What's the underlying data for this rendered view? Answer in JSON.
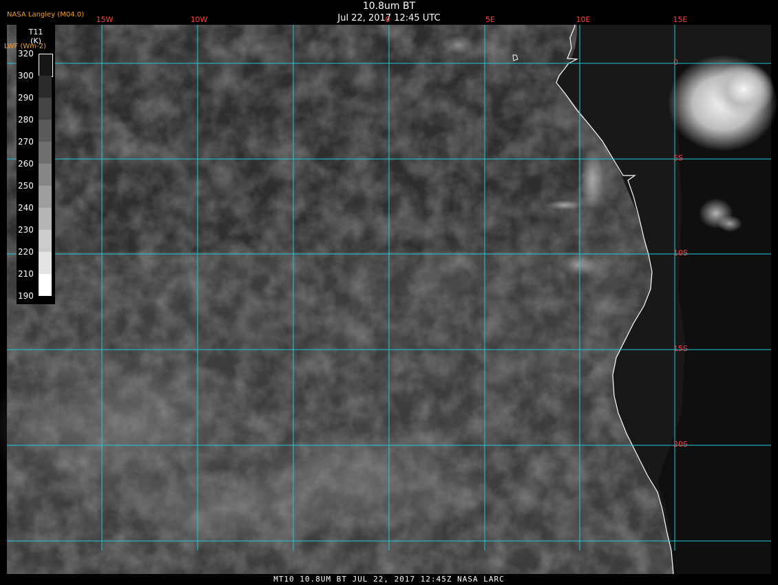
{
  "header": {
    "title": "10.8um BT",
    "subtitle": "Jul 22, 2017 12:45 UTC",
    "credit": "NASA Langley (M04.0)"
  },
  "colorbar": {
    "title": "T11",
    "unit": "(K)",
    "secondary_label": "LWF (Wm-2)",
    "ticks": [
      "320",
      "300",
      "290",
      "280",
      "270",
      "260",
      "250",
      "240",
      "230",
      "220",
      "210",
      "190"
    ]
  },
  "grid": {
    "longitudes": [
      "15W",
      "10W",
      "0",
      "5E",
      "10E",
      "15E"
    ],
    "latitudes": [
      "0",
      "5S",
      "10S",
      "15S",
      "20S"
    ]
  },
  "footer": {
    "text": "MT10  10.8UM BT   JUL 22, 2017 12:45Z  NASA LARC"
  },
  "colors": {
    "gridline": "#20c8d8",
    "label": "#ff4040",
    "credit": "#f0a030",
    "ocean": "#3b3b3b",
    "land": "#141414"
  }
}
